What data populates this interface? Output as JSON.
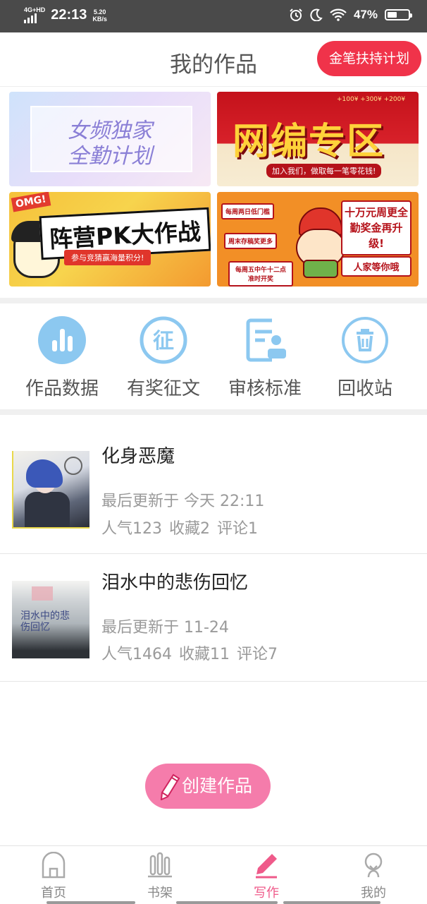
{
  "status_bar": {
    "network": "4G+HD",
    "time": "22:13",
    "speed_value": "5.20",
    "speed_unit": "KB/s",
    "battery": "47%",
    "battery_level": 0.47
  },
  "header": {
    "title": "我的作品",
    "plan_button": "金笔扶持计划"
  },
  "banners": {
    "female_exclusive": {
      "line1": "女频独家",
      "line2": "全勤计划"
    },
    "web_novel": {
      "title": "网编专区",
      "subtitle": "加入我们，做取每一笔零花钱!",
      "money": "+100¥  +300¥  +200¥"
    },
    "camp_pk": {
      "omg": "OMG!",
      "title": "阵营PK大作战",
      "subtitle": "参与竞猜赢海量积分!"
    },
    "bonus": {
      "note1": "每周两日低门槛",
      "note2": "周末存稿奖更多",
      "note3": "每周五中午十二点准时开奖",
      "headline": "十万元周更全勤奖金再升级!",
      "tag": "人家等你哦"
    }
  },
  "menu": [
    {
      "label": "作品数据",
      "icon": "bar-chart-icon"
    },
    {
      "label": "有奖征文",
      "icon": "contest-icon",
      "glyph": "征"
    },
    {
      "label": "审核标准",
      "icon": "review-document-icon"
    },
    {
      "label": "回收站",
      "icon": "trash-icon"
    }
  ],
  "works": [
    {
      "title": "化身恶魔",
      "updated": "最后更新于 今天 22:11",
      "popularity": "人气123",
      "favorites": "收藏2",
      "comments": "评论1"
    },
    {
      "title": "泪水中的悲伤回忆",
      "updated": "最后更新于 11-24",
      "popularity": "人气1464",
      "favorites": "收藏11",
      "comments": "评论7",
      "cover_text": "泪水中的悲伤回忆"
    }
  ],
  "create_button": "创建作品",
  "tabs": [
    {
      "label": "首页",
      "icon": "home-icon",
      "active": false
    },
    {
      "label": "书架",
      "icon": "bookshelf-icon",
      "active": false
    },
    {
      "label": "写作",
      "icon": "pen-icon",
      "active": true
    },
    {
      "label": "我的",
      "icon": "profile-icon",
      "active": false
    }
  ],
  "colors": {
    "accent_red": "#f0334a",
    "create_pink": "#f57cab",
    "active_tab": "#ef5a8a",
    "menu_blue": "#8cc8f0"
  }
}
